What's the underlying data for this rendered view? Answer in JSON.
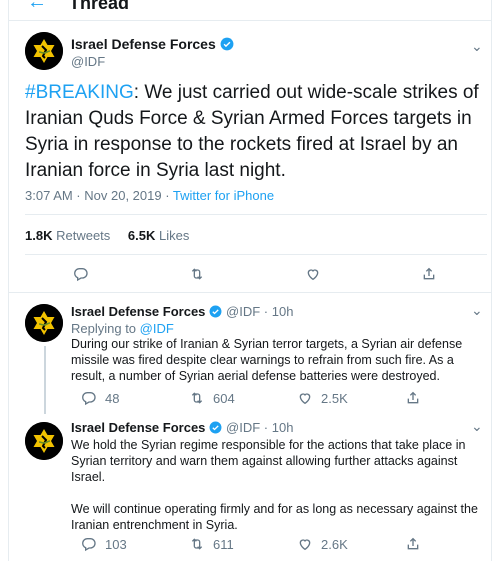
{
  "header": {
    "back_icon": "arrow-left-icon",
    "title": "Thread"
  },
  "main_tweet": {
    "author_name": "Israel Defense Forces",
    "handle": "@IDF",
    "hashtag": "#BREAKING",
    "text": ": We just carried out wide-scale strikes of Iranian Quds Force & Syrian Armed Forces targets in Syria in response to the rockets fired at Israel by an Iranian force in Syria last night.",
    "timestamp": "3:07 AM · Nov 20, 2019 · ",
    "source": "Twitter for iPhone",
    "retweets_count": "1.8K",
    "retweets_label": "Retweets",
    "likes_count": "6.5K",
    "likes_label": "Likes"
  },
  "replies": [
    {
      "author_name": "Israel Defense Forces",
      "handle": "@IDF",
      "time": "· 10h",
      "replying_prefix": "Replying to ",
      "replying_to": "@IDF",
      "text": "During our strike of Iranian & Syrian terror targets, a Syrian air defense missile was fired despite clear warnings to refrain from such fire. As a result, a number of Syrian aerial defense batteries were destroyed.",
      "reply_count": "48",
      "retweet_count": "604",
      "like_count": "2.5K"
    },
    {
      "author_name": "Israel Defense Forces",
      "handle": "@IDF",
      "time": "· 10h",
      "text": "We hold the Syrian regime responsible for the actions that take place in Syrian territory and warn them against allowing further attacks against Israel.\n\nWe will continue operating firmly and for as long as necessary against the Iranian entrenchment in Syria.",
      "reply_count": "103",
      "retweet_count": "611",
      "like_count": "2.6K"
    }
  ],
  "colors": {
    "accent": "#1da1f2",
    "muted": "#657786",
    "text": "#14171a",
    "border": "#e6ecf0"
  }
}
